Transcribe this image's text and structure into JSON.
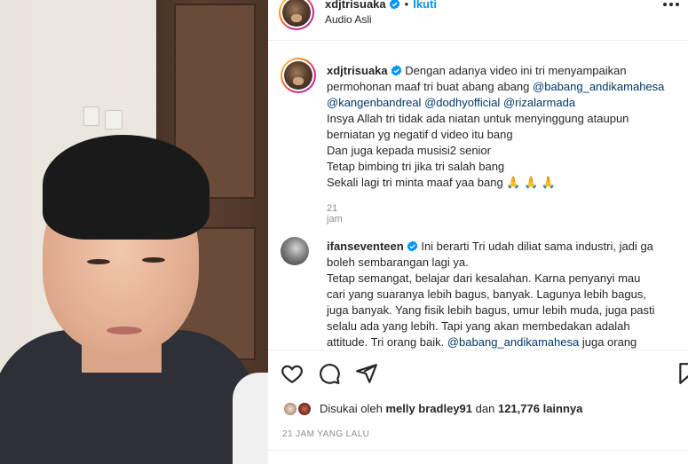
{
  "header": {
    "username": "xdjtrisuaka",
    "separator": "•",
    "follow_label": "Ikuti",
    "audio": "Audio Asli"
  },
  "comments": [
    {
      "username": "xdjtrisuaka",
      "lines": [
        [
          {
            "t": "Dengan adanya video ini tri menyampaikan"
          }
        ],
        [
          {
            "t": "permohonan maaf tri buat abang abang "
          },
          {
            "t": "@babang_andikamahesa",
            "m": true
          }
        ],
        [
          {
            "t": "@kangenbandreal",
            "m": true
          },
          {
            "t": " "
          },
          {
            "t": "@dodhyofficial",
            "m": true
          },
          {
            "t": " "
          },
          {
            "t": "@rizalarmada",
            "m": true
          }
        ],
        [
          {
            "t": "Insya Allah tri tidak ada niatan untuk menyinggung ataupun"
          }
        ],
        [
          {
            "t": "berniatan yg negatif d video itu bang"
          }
        ],
        [
          {
            "t": "Dan juga kepada musisi2 senior"
          }
        ],
        [
          {
            "t": "Tetap bimbing tri jika tri salah bang"
          }
        ],
        [
          {
            "t": "Sekali lagi tri minta maaf yaa bang 🙏 🙏 🙏"
          }
        ]
      ],
      "time": "21 jam"
    },
    {
      "username": "ifanseventeen",
      "lines": [
        [
          {
            "t": "Ini berarti Tri udah diliat sama industri, jadi ga"
          }
        ],
        [
          {
            "t": "boleh sembarangan lagi ya."
          }
        ],
        [
          {
            "t": "Tetap semangat, belajar dari kesalahan. Karna penyanyi mau"
          }
        ],
        [
          {
            "t": "cari yang suaranya lebih bagus, banyak. Lagunya lebih bagus,"
          }
        ],
        [
          {
            "t": "juga banyak. Yang fisik lebih bagus, umur lebih muda, juga pasti"
          }
        ],
        [
          {
            "t": "selalu ada yang lebih. Tapi yang akan membedakan adalah"
          }
        ],
        [
          {
            "t": "attitude. Tri orang baik. "
          },
          {
            "t": "@babang_andikamahesa",
            "m": true
          },
          {
            "t": " juga orang"
          }
        ]
      ]
    }
  ],
  "likes": {
    "prefix": "Disukai oleh",
    "user": "melly bradley91",
    "middle": "dan",
    "count": "121,776",
    "suffix": "lainnya"
  },
  "date": "21 JAM YANG LALU",
  "colors": {
    "follow": "#0095f6",
    "mention": "#00376b",
    "verified": "#0095f6",
    "muted": "#8e8e8e"
  }
}
